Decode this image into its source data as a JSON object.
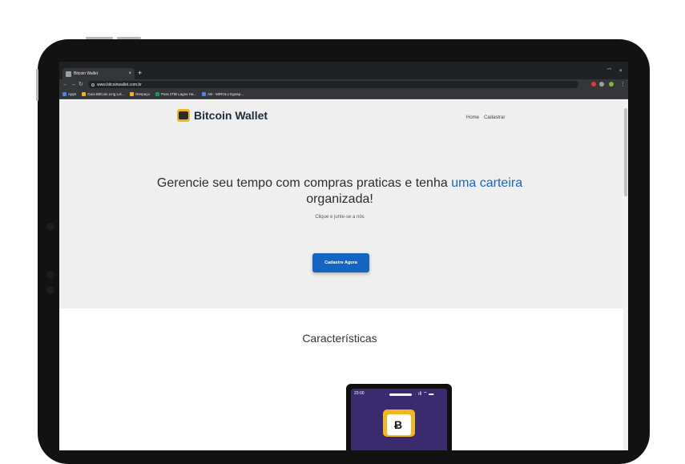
{
  "browser": {
    "tab_title": "Bitcoin Wallet",
    "tab_close": "×",
    "new_tab": "+",
    "window_controls": [
      "⁀",
      "×"
    ],
    "url": "www.bitcoinwallet.com.br",
    "bookmarks": [
      {
        "label": "Apps",
        "color": "#4285f4"
      },
      {
        "label": "Guia BitCoin Ling Lol...",
        "color": "#f4b400"
      },
      {
        "label": "Respaço",
        "color": "#f4b400"
      },
      {
        "label": "Para 2TiB Lagos Ha...",
        "color": "#0f9d58"
      },
      {
        "label": "AB - MIROLo Egeap...",
        "color": "#4285f4"
      }
    ]
  },
  "site": {
    "brand": "Bitcoin Wallet",
    "nav": [
      "Home",
      "Cadastrar"
    ],
    "hero_title_part1": "Gerencie seu tempo com compras praticas e tenha ",
    "hero_title_highlight": "uma carteira",
    "hero_title_part2": "organizada!",
    "hero_subtitle": "Clique e junte-se a nós",
    "cta_label": "Cadastre Agora",
    "features_title": "Características",
    "phone_time": "23:00",
    "phone_icons": "ıll ⌔ ▬",
    "phone_coin": "Ƀ"
  },
  "colors": {
    "accent": "#1a66c2",
    "button": "#1565c0",
    "wallet": "#f1b620",
    "hero_bg": "#efefef"
  }
}
